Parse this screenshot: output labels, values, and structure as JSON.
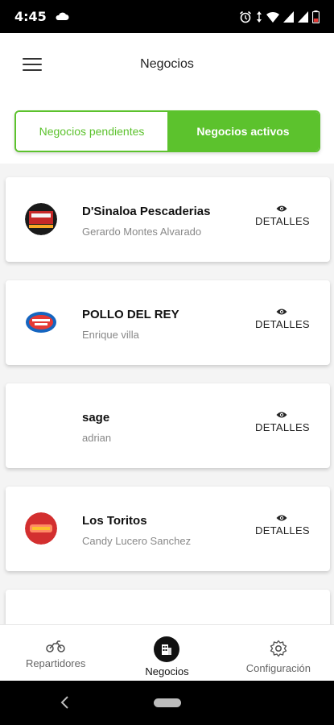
{
  "status_bar": {
    "time": "4:45",
    "icons": [
      "cloud-icon",
      "alarm-icon",
      "data-arrows-icon",
      "wifi-icon",
      "signal-icon",
      "signal-icon",
      "battery-low-icon"
    ],
    "battery_color": "#e53935"
  },
  "app_bar": {
    "title": "Negocios",
    "menu_icon": "hamburger-menu-icon"
  },
  "tabs": {
    "pending_label": "Negocios pendientes",
    "active_label": "Negocios activos",
    "selected": "active",
    "accent_color": "#5cc22d"
  },
  "businesses": [
    {
      "name": "D'Sinaloa Pescaderias",
      "owner": "Gerardo Montes Alvarado",
      "detail_label": "DETALLES",
      "logo": "dsinaloa-logo"
    },
    {
      "name": "POLLO DEL REY",
      "owner": "Enrique villa",
      "detail_label": "DETALLES",
      "logo": "pollo-del-rey-logo"
    },
    {
      "name": "sage",
      "owner": "adrian",
      "detail_label": "DETALLES",
      "logo": ""
    },
    {
      "name": "Los Toritos",
      "owner": "Candy Lucero Sanchez",
      "detail_label": "DETALLES",
      "logo": "los-toritos-logo"
    }
  ],
  "bottom_nav": {
    "items": [
      {
        "label": "Repartidores",
        "icon": "motorcycle-icon"
      },
      {
        "label": "Negocios",
        "icon": "building-icon",
        "active": true
      },
      {
        "label": "Configuración",
        "icon": "gear-icon"
      }
    ]
  }
}
